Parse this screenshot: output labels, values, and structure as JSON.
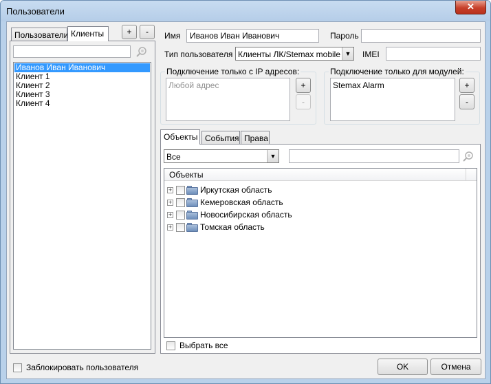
{
  "window": {
    "title": "Пользователи",
    "close_label": "✕"
  },
  "left": {
    "tabs": [
      "Пользователи",
      "Клиенты"
    ],
    "add_label": "+",
    "remove_label": "-",
    "search_value": "",
    "items": [
      "Иванов Иван Иванович",
      "Клиент 1",
      "Клиент 2",
      "Клиент 3",
      "Клиент 4"
    ]
  },
  "form": {
    "name_label": "Имя",
    "name_value": "Иванов Иван Иванович",
    "password_label": "Пароль",
    "password_value": "",
    "type_label": "Тип пользователя",
    "type_value": "Клиенты ЛК/Stemax mobile",
    "imei_label": "IMEI",
    "imei_value": ""
  },
  "ip_group": {
    "title": "Подключение только с IP адресов:",
    "placeholder": "Любой адрес",
    "add_label": "+",
    "remove_label": "-"
  },
  "modules_group": {
    "title": "Подключение только для модулей:",
    "items": [
      "Stemax Alarm"
    ],
    "add_label": "+",
    "remove_label": "-"
  },
  "tabs": [
    "Объекты",
    "События",
    "Права"
  ],
  "objects": {
    "filter_value": "Все",
    "search_value": "",
    "column_header": "Объекты",
    "tree": [
      "Иркутская область",
      "Кемеровская область",
      "Новосибирская область",
      "Томская область"
    ],
    "select_all_label": "Выбрать все"
  },
  "footer": {
    "block_label": "Заблокировать пользователя",
    "ok_label": "OK",
    "cancel_label": "Отмена"
  },
  "colors": {
    "selection": "#3399ff",
    "title_bar": "#b9d1ea",
    "close_button": "#c7402a"
  }
}
